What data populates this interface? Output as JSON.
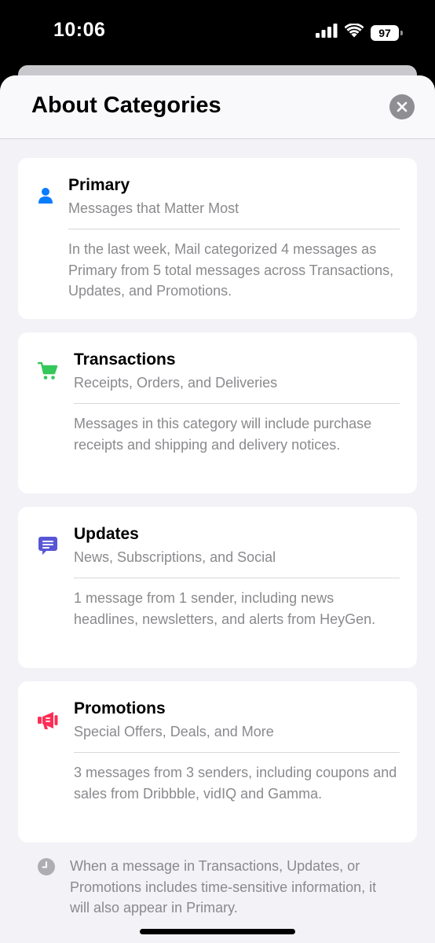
{
  "status_bar": {
    "time": "10:06",
    "battery": "97",
    "icons": [
      "signal-icon",
      "wifi-icon",
      "battery-icon"
    ]
  },
  "header": {
    "title": "About Categories",
    "close_icon": "close-icon"
  },
  "cards": [
    {
      "icon": "person-icon",
      "icon_color": "#0a7cff",
      "title": "Primary",
      "subtitle": "Messages that Matter Most",
      "description": "In the last week, Mail categorized 4 messages as Primary from 5 total messages across Transactions, Updates, and Promotions."
    },
    {
      "icon": "cart-icon",
      "icon_color": "#34c759",
      "title": "Transactions",
      "subtitle": "Receipts, Orders, and Deliveries",
      "description": "Messages in this category will include purchase receipts and shipping and delivery notices."
    },
    {
      "icon": "message-icon",
      "icon_color": "#5856d6",
      "title": "Updates",
      "subtitle": "News, Subscriptions, and Social",
      "description": "1 message from 1 sender, including news headlines, newsletters, and alerts from HeyGen."
    },
    {
      "icon": "megaphone-icon",
      "icon_color": "#ff2d55",
      "title": "Promotions",
      "subtitle": "Special Offers, Deals, and More",
      "description": "3 messages from 3 senders, including coupons and sales from Dribbble, vidIQ and Gamma."
    }
  ],
  "footnote": {
    "icon": "clock-icon",
    "text": "When a message in Transactions, Updates, or Promotions includes time-sensitive information, it will also appear in Primary."
  }
}
